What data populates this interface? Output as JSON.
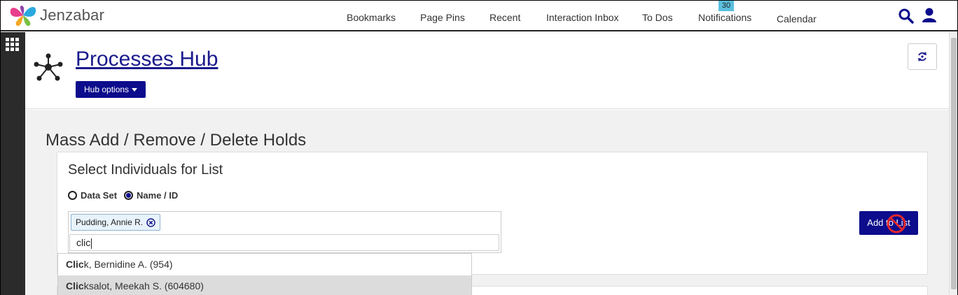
{
  "brand": {
    "name": "Jenzabar"
  },
  "nav": {
    "items": [
      {
        "label": "Bookmarks"
      },
      {
        "label": "Page Pins"
      },
      {
        "label": "Recent"
      },
      {
        "label": "Interaction Inbox"
      },
      {
        "label": "To Dos"
      },
      {
        "label": "Notifications"
      },
      {
        "label": "Calendar"
      }
    ],
    "notifications_count": "30"
  },
  "header": {
    "title": "Processes Hub",
    "options_label": "Hub options"
  },
  "page": {
    "title": "Mass Add / Remove / Delete Holds"
  },
  "card": {
    "title": "Select Individuals for List",
    "radio_data_set": "Data Set",
    "radio_name_id": "Name / ID",
    "selected_radio": "Name / ID",
    "tag_label": "Pudding, Annie R.",
    "input_value": "clic",
    "add_button": "Add to List"
  },
  "dropdown": {
    "items": [
      {
        "match": "Clic",
        "rest": "k, Bernidine A. (954)"
      },
      {
        "match": "Clic",
        "rest": "ksalot, Meekah S. (604680)"
      }
    ],
    "active_index": 1
  },
  "colors": {
    "primary": "#0c0c8c",
    "badge": "#5bc0de",
    "rail": "#2b2b2b"
  }
}
